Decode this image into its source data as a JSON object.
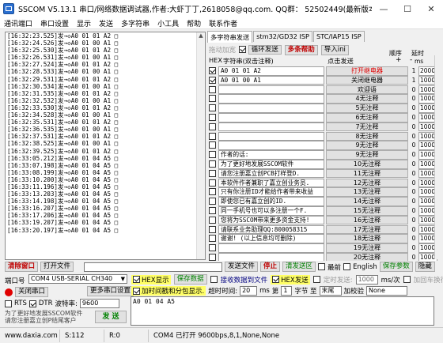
{
  "window": {
    "title": "SSCOM V5.13.1 串口/网络数据调试器,作者:大虾丁丁,2618058@qq.com. QQ群： 52502449(最新版本)"
  },
  "menu": [
    "通讯端口",
    "串口设置",
    "显示",
    "发送",
    "多字符串",
    "小工具",
    "帮助",
    "联系作者"
  ],
  "log_lines": [
    "[16:32:23.525]发→◇A0 01 01 A2 □",
    "[16:32:24.526]发→◇A0 01 00 A1 □",
    "[16:32:25.530]发→◇A0 01 01 A2 □",
    "[16:32:26.531]发→◇A0 01 00 A1 □",
    "[16:32:27.524]发→◇A0 01 01 A2 □",
    "[16:32:28.533]发→◇A0 01 00 A1 □",
    "[16:32:29.531]发→◇A0 01 01 A2 □",
    "[16:32:30.534]发→◇A0 01 00 A1 □",
    "[16:32:31.535]发→◇A0 01 01 A2 □",
    "[16:32:32.532]发→◇A0 01 00 A1 □",
    "[16:32:33.530]发→◇A0 01 01 A2 □",
    "[16:32:34.528]发→◇A0 01 00 A1 □",
    "[16:32:35.531]发→◇A0 01 01 A2 □",
    "[16:32:36.535]发→◇A0 01 00 A1 □",
    "[16:32:37.531]发→◇A0 01 01 A2 □",
    "[16:32:38.525]发→◇A0 01 00 A1 □",
    "[16:32:39.525]发→◇A0 01 01 A2 □",
    "[16:33:05.212]发→◇A0 01 04 A5 □",
    "[16:33:07.198]发→◇A0 01 04 A5 □",
    "[16:33:08.199]发→◇A0 01 04 A5 □",
    "[16:33:10.200]发→◇A0 01 04 A5 □",
    "[16:33:11.196]发→◇A0 01 04 A5 □",
    "[16:33:13.203]发→◇A0 01 04 A5 □",
    "[16:33:14.198]发→◇A0 01 04 A5 □",
    "[16:33:16.207]发→◇A0 01 04 A5 □",
    "[16:33:17.206]发→◇A0 01 04 A5 □",
    "[16:33:19.207]发→◇A0 01 04 A5 □",
    "[16:33:20.197]发→◇A0 01 04 A5 □"
  ],
  "tabs": [
    "多字符串发送",
    "stm32/GD32 ISP",
    "STC/IAP15 ISP"
  ],
  "toolbar": {
    "loop_label": "拖动加宽",
    "cycle_label": "循环发送",
    "help_label": "多条帮助",
    "import_label": "导入ini"
  },
  "header": {
    "hex": "HEX",
    "string": "字符串(双击注释)",
    "click": "点击发送",
    "order": "顺序",
    "delay": "延时",
    "ms": "ms"
  },
  "rows": [
    {
      "hex": true,
      "text": "A0 01 01 A2",
      "button": "打开继电器",
      "n": "1",
      "d": "2000",
      "red": true
    },
    {
      "hex": true,
      "text": "A0 01 00 A1",
      "button": "关闭继电器",
      "n": "1",
      "d": "1000",
      "red": false
    },
    {
      "hex": false,
      "text": "",
      "button": "欢迎语",
      "n": "0",
      "d": "1000",
      "red": false
    },
    {
      "hex": false,
      "text": "",
      "button": "4无注释",
      "n": "0",
      "d": "1000",
      "red": false
    },
    {
      "hex": false,
      "text": "",
      "button": "5无注释",
      "n": "0",
      "d": "1000",
      "red": false
    },
    {
      "hex": false,
      "text": "",
      "button": "6无注释",
      "n": "0",
      "d": "1000",
      "red": false
    },
    {
      "hex": false,
      "text": "",
      "button": "7无注释",
      "n": "0",
      "d": "1000",
      "red": false
    },
    {
      "hex": false,
      "text": "",
      "button": "8无注释",
      "n": "0",
      "d": "1000",
      "red": false
    },
    {
      "hex": false,
      "text": "",
      "button": "9无注释",
      "n": "0",
      "d": "1000",
      "red": false
    },
    {
      "hex": false,
      "text": "作者的话:",
      "button": "9无注释",
      "n": "0",
      "d": "1000",
      "red": false
    },
    {
      "hex": false,
      "text": "为了更好地发展SSCOM软件",
      "button": "10无注释",
      "n": "0",
      "d": "1000",
      "red": false
    },
    {
      "hex": false,
      "text": "请您注册嘉立创PCB打样登D.",
      "button": "11无注释",
      "n": "0",
      "d": "1000",
      "red": false
    },
    {
      "hex": false,
      "text": "本软件作者兼职了嘉立创业务员.",
      "button": "12无注释",
      "n": "0",
      "d": "1000",
      "red": false
    },
    {
      "hex": false,
      "text": "只有你注册ID才能给作者带来收益",
      "button": "13无注释",
      "n": "0",
      "d": "1000",
      "red": false
    },
    {
      "hex": false,
      "text": "即使您已有嘉立创的ID.",
      "button": "14无注释",
      "n": "0",
      "d": "1000",
      "red": false
    },
    {
      "hex": false,
      "text": "同一手机号也可以多注册一个F.",
      "button": "15无注释",
      "n": "0",
      "d": "1000",
      "red": false
    },
    {
      "hex": false,
      "text": "您将为SSCOM带来更多资金支持!",
      "button": "16无注释",
      "n": "0",
      "d": "1000",
      "red": false
    },
    {
      "hex": false,
      "text": "请联系业务助理QQ:800058315",
      "button": "17无注释",
      "n": "0",
      "d": "1000",
      "red": false
    },
    {
      "hex": false,
      "text": "谢谢! (以上信息均可删除)",
      "button": "18无注释",
      "n": "0",
      "d": "1000",
      "red": false
    },
    {
      "hex": false,
      "text": "",
      "button": "19无注释",
      "n": "0",
      "d": "1000",
      "red": false
    },
    {
      "hex": false,
      "text": "",
      "button": "20无注释",
      "n": "0",
      "d": "1000",
      "red": false
    }
  ],
  "bottom": {
    "clear_window": "清除窗口",
    "open_file": "打开文件",
    "send_file": "发送文件",
    "stop": "停止",
    "clear_send": "清发送区",
    "topmost": "最前",
    "english": "English",
    "save_params": "保存参数",
    "hide": "隐藏",
    "port_label": "端口号",
    "port_value": "COM4 USB-SERIAL CH340",
    "hex_display": "HEX显示",
    "save_data": "保存数据",
    "recv_to_file": "接收数据到文件",
    "hex_send": "HEX发送",
    "timed_send": "定时发送:",
    "timed_ms": "1000",
    "timed_unit": "ms/次",
    "add_crlf": "加回车换行",
    "close_port": "关闭串口",
    "more_settings": "更多串口设置",
    "add_timestamp": "加时间戳和分包显示.",
    "timeout_label": "超时时间:",
    "timeout_value": "20",
    "timeout_unit": "ms",
    "byte_label": "第",
    "byte_value": "1",
    "byte_unit": "字节 至",
    "end_value": "末尾",
    "checksum_label": "加校验",
    "checksum_value": "None",
    "rts": "RTS",
    "dtr": "DTR",
    "baud_label": "波特率:",
    "baud_value": "9600",
    "send_text": "A0 01 04 A5",
    "promo_line1": "为了更好地发展SSCOM软件",
    "promo_line2": "请您注册嘉立创P结尾客户",
    "send_button": "发 送"
  },
  "status": {
    "site": "www.daxia.com",
    "s": "S:112",
    "r": "R:0",
    "port": "COM4 已打开  9600bps,8,1,None,None"
  }
}
